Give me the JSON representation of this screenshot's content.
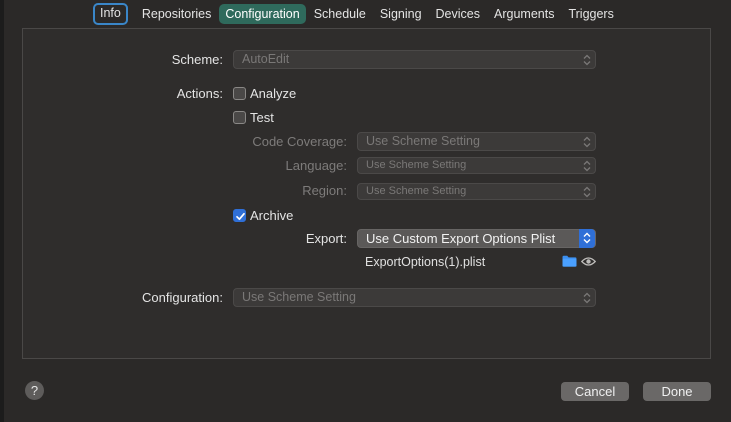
{
  "tabs": [
    {
      "label": "Info"
    },
    {
      "label": "Repositories"
    },
    {
      "label": "Configuration"
    },
    {
      "label": "Schedule"
    },
    {
      "label": "Signing"
    },
    {
      "label": "Devices"
    },
    {
      "label": "Arguments"
    },
    {
      "label": "Triggers"
    }
  ],
  "selected_tab": "Configuration",
  "form": {
    "scheme": {
      "label": "Scheme:",
      "value": "AutoEdit"
    },
    "actions": {
      "label": "Actions:",
      "analyze": {
        "label": "Analyze",
        "checked": false
      },
      "test": {
        "label": "Test",
        "checked": false
      }
    },
    "code_coverage": {
      "label": "Code Coverage:",
      "value": "Use Scheme Setting"
    },
    "language": {
      "label": "Language:",
      "value": "Use Scheme Setting"
    },
    "region": {
      "label": "Region:",
      "value": "Use Scheme Setting"
    },
    "archive": {
      "label": "Archive",
      "checked": true
    },
    "export": {
      "label": "Export:",
      "value": "Use Custom Export Options Plist",
      "file": "ExportOptions(1).plist"
    },
    "configuration": {
      "label": "Configuration:",
      "value": "Use Scheme Setting"
    }
  },
  "footer": {
    "help": "?",
    "cancel": "Cancel",
    "done": "Done"
  },
  "colors": {
    "accent": "#2f6fd7",
    "selected_tab": "#2f6a5c",
    "focus_ring": "#3a86c8"
  },
  "icons": [
    "chevron-updown-icon",
    "checkmark-icon",
    "folder-icon",
    "eye-icon"
  ]
}
